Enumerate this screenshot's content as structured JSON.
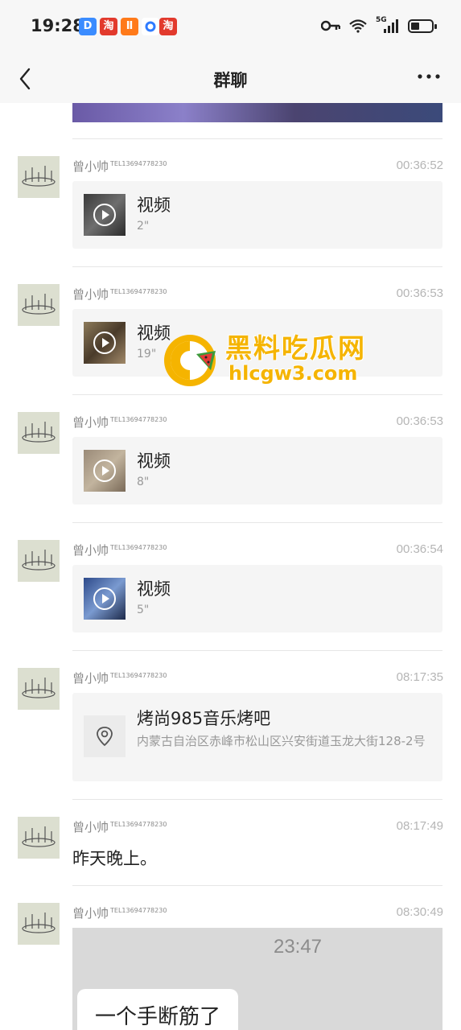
{
  "status_bar": {
    "time": "19:28",
    "apps": [
      {
        "icon": "app-d-icon",
        "label": "D",
        "color": "#3b8cff"
      },
      {
        "icon": "taobao-icon",
        "label": "淘",
        "color": "#e23a2d"
      },
      {
        "icon": "app-orange-icon",
        "label": "Ⅱ",
        "color": "#ff7a1a"
      },
      {
        "icon": "app-circle-icon",
        "label": "",
        "color": "#2f7bff"
      },
      {
        "icon": "taobao-icon",
        "label": "淘",
        "color": "#e23a2d"
      }
    ],
    "signal": "5G"
  },
  "nav": {
    "title": "群聊",
    "back_icon": "chevron-left-icon",
    "more_icon": "more-dots-icon"
  },
  "messages": [
    {
      "sender": "曾小帅",
      "tel": "TEL13694778230",
      "time": "00:36:52",
      "type": "video",
      "title": "视频",
      "duration": "2\""
    },
    {
      "sender": "曾小帅",
      "tel": "TEL13694778230",
      "time": "00:36:53",
      "type": "video",
      "title": "视频",
      "duration": "19\""
    },
    {
      "sender": "曾小帅",
      "tel": "TEL13694778230",
      "time": "00:36:53",
      "type": "video",
      "title": "视频",
      "duration": "8\""
    },
    {
      "sender": "曾小帅",
      "tel": "TEL13694778230",
      "time": "00:36:54",
      "type": "video",
      "title": "视频",
      "duration": "5\""
    },
    {
      "sender": "曾小帅",
      "tel": "TEL13694778230",
      "time": "08:17:35",
      "type": "location",
      "title": "烤尚985音乐烤吧",
      "address": "内蒙古自治区赤峰市松山区兴安街道玉龙大街128-2号"
    },
    {
      "sender": "曾小帅",
      "tel": "TEL13694778230",
      "time": "08:17:49",
      "type": "text",
      "text": "昨天晚上。"
    },
    {
      "sender": "曾小帅",
      "tel": "TEL13694778230",
      "time": "08:30:49",
      "type": "image",
      "image_time": "23:47",
      "image_text": "一个手断筋了"
    }
  ],
  "watermark": {
    "title": "黑料吃瓜网",
    "url": "hlcgw3.com",
    "color": "#f5b400"
  }
}
